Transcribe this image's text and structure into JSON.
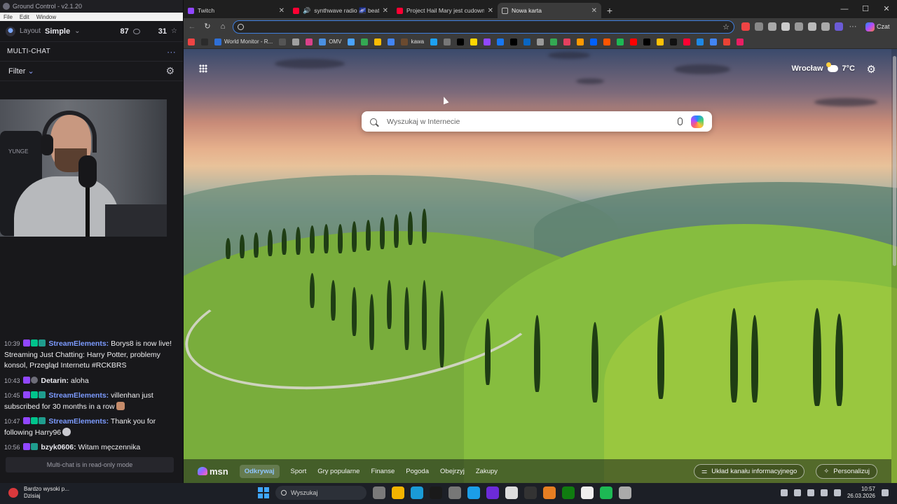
{
  "gc": {
    "title": "Ground Control - v2.1.20",
    "menu": [
      "File",
      "Edit",
      "Window"
    ],
    "toolbar": {
      "layout_label": "Layout",
      "layout_value": "Simple",
      "viewers": "87",
      "followers": "31"
    },
    "section_title": "MULTI-CHAT",
    "section_more": "···",
    "filter_label": "Filter",
    "webcam_text": "YUNGE",
    "chat": [
      {
        "time": "10:39",
        "user": "StreamElements:",
        "text": "Borys8 is now live! Streaming Just Chatting: Harry Potter, problemy konsol, Przegląd Internetu #RCKBRS"
      },
      {
        "time": "10:43",
        "user": "Detarin:",
        "text": "aloha"
      },
      {
        "time": "10:45",
        "user": "StreamElements:",
        "text": "villenhan just subscribed for 30 months in a row"
      },
      {
        "time": "10:47",
        "user": "StreamElements:",
        "text": "Thank you for following Harry96"
      },
      {
        "time": "10:56",
        "user": "bzyk0606:",
        "text": "Witam męczennika"
      }
    ],
    "readonly": "Multi-chat is in read-only mode"
  },
  "browser": {
    "tabs": [
      {
        "label": "Twitch",
        "color": "#9147ff"
      },
      {
        "label": "synthwave radio 🌌 beats to",
        "color": "#ff0033"
      },
      {
        "label": "Project Hail Mary jest cudowny - Y",
        "color": "#ff0033"
      },
      {
        "label": "Nowa karta",
        "color": "#9aa0a6"
      }
    ],
    "window_controls": [
      "—",
      "☐",
      "✕"
    ],
    "address_value": "",
    "chat_button": "Czat",
    "favorites": [
      {
        "label": "World Monitor - R...",
        "color": "#2f6fd6"
      },
      {
        "label": "OMV",
        "color": "#4a90e2"
      },
      {
        "label": "kawa",
        "color": "#6b4a2f"
      }
    ],
    "fav_icon_colors": [
      "#e44",
      "#2b2b2b",
      "#555",
      "#a0a0a0",
      "#d9418a",
      "#4aa3ff",
      "#34a853",
      "#fbbc04",
      "#4285f4",
      "#1da1f2",
      "#777",
      "#000",
      "#ffd600",
      "#9147ff",
      "#1877f2",
      "#000",
      "#0a66c2",
      "#999",
      "#34a853",
      "#e4405f",
      "#ff9900",
      "#0061ff",
      "#ff5500",
      "#1db954",
      "#ff0000",
      "#000",
      "#ffc107",
      "#111",
      "#ff0033",
      "#1e88e5",
      "#4285f4",
      "#ea4335",
      "#e91e63"
    ],
    "ext_icon_colors": [
      "#e44",
      "#888",
      "#aaa",
      "#ccc",
      "#999",
      "#bbb",
      "#aaa",
      "#6b5bd6"
    ]
  },
  "ntp": {
    "search_placeholder": "Wyszukaj w Internecie",
    "weather_city": "Wrocław",
    "weather_temp": "7°C",
    "msn_logo": "msn",
    "msn_tabs": [
      "Odkrywaj",
      "Sport",
      "Gry popularne",
      "Finanse",
      "Pogoda",
      "Obejrzyj",
      "Zakupy"
    ],
    "feed_layout": "Układ kanału informacyjnego",
    "personalize": "Personalizuj"
  },
  "taskbar": {
    "weather_title": "Bardzo wysoki p...",
    "weather_sub": "Dzisiaj",
    "search": "Wyszukaj",
    "time": "10:57",
    "date": "26.03.2026",
    "app_colors": [
      "#7a7a7a",
      "#f4b400",
      "#1a9bd7",
      "#1a1a1a",
      "#777",
      "#1b9ee8",
      "#6c2bd9",
      "#ddd",
      "#333",
      "#e67e22",
      "#107c10",
      "#eee",
      "#1db954",
      "#aaa"
    ]
  }
}
